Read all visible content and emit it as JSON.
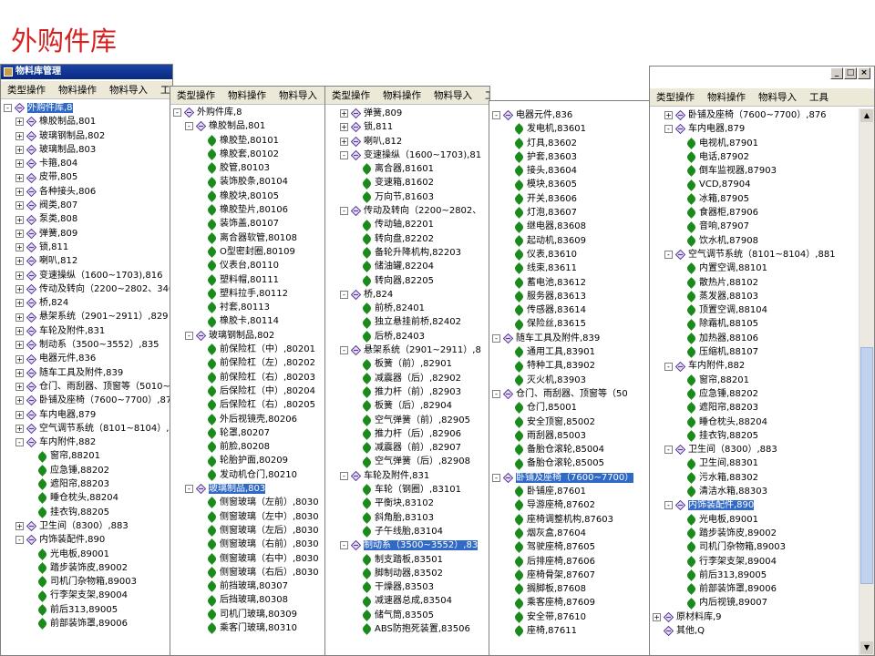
{
  "slide_title": "外购件库",
  "window": {
    "title": "物料库管理",
    "min": "_",
    "max": "□",
    "close": "×"
  },
  "panels": [
    {
      "menu": [
        "类型操作",
        "物料操作",
        "物料导入",
        "工具"
      ],
      "rows": [
        {
          "d": 0,
          "t": "n",
          "e": "-",
          "l": "外购件库,8",
          "s": true
        },
        {
          "d": 1,
          "t": "n",
          "e": "+",
          "l": "橡胶制品,801"
        },
        {
          "d": 1,
          "t": "n",
          "e": "+",
          "l": "玻璃钢制品,802"
        },
        {
          "d": 1,
          "t": "n",
          "e": "+",
          "l": "玻璃制品,803"
        },
        {
          "d": 1,
          "t": "n",
          "e": "+",
          "l": "卡箍,804"
        },
        {
          "d": 1,
          "t": "n",
          "e": "+",
          "l": "皮带,805"
        },
        {
          "d": 1,
          "t": "n",
          "e": "+",
          "l": "各种接头,806"
        },
        {
          "d": 1,
          "t": "n",
          "e": "+",
          "l": "阀类,807"
        },
        {
          "d": 1,
          "t": "n",
          "e": "+",
          "l": "泵类,808"
        },
        {
          "d": 1,
          "t": "n",
          "e": "+",
          "l": "弹簧,809"
        },
        {
          "d": 1,
          "t": "n",
          "e": "+",
          "l": "锁,811"
        },
        {
          "d": 1,
          "t": "n",
          "e": "+",
          "l": "喇叭,812"
        },
        {
          "d": 1,
          "t": "n",
          "e": "+",
          "l": "变速操纵（1600~1703),816"
        },
        {
          "d": 1,
          "t": "n",
          "e": "+",
          "l": "传动及转向（2200~2802、3400~34"
        },
        {
          "d": 1,
          "t": "n",
          "e": "+",
          "l": "桥,824"
        },
        {
          "d": 1,
          "t": "n",
          "e": "+",
          "l": "悬架系统（2901~2911）,829"
        },
        {
          "d": 1,
          "t": "n",
          "e": "+",
          "l": "车轮及附件,831"
        },
        {
          "d": 1,
          "t": "n",
          "e": "+",
          "l": "制动系（3500~3552）,835"
        },
        {
          "d": 1,
          "t": "n",
          "e": "+",
          "l": "电器元件,836"
        },
        {
          "d": 1,
          "t": "n",
          "e": "+",
          "l": "随车工具及附件,839"
        },
        {
          "d": 1,
          "t": "n",
          "e": "+",
          "l": "仓门、雨刮器、顶窗等（5010~6701"
        },
        {
          "d": 1,
          "t": "n",
          "e": "+",
          "l": "卧铺及座椅（7600~7700）,876"
        },
        {
          "d": 1,
          "t": "n",
          "e": "+",
          "l": "车内电器,879"
        },
        {
          "d": 1,
          "t": "n",
          "e": "+",
          "l": "空气调节系统（8101~8104）,881"
        },
        {
          "d": 1,
          "t": "n",
          "e": "-",
          "l": "车内附件,882"
        },
        {
          "d": 2,
          "t": "l",
          "l": "窗帘,88201"
        },
        {
          "d": 2,
          "t": "l",
          "l": "应急锤,88202"
        },
        {
          "d": 2,
          "t": "l",
          "l": "遮阳帘,88203"
        },
        {
          "d": 2,
          "t": "l",
          "l": "睡仓枕头,88204"
        },
        {
          "d": 2,
          "t": "l",
          "l": "挂衣钩,88205"
        },
        {
          "d": 1,
          "t": "n",
          "e": "+",
          "l": "卫生间（8300）,883"
        },
        {
          "d": 1,
          "t": "n",
          "e": "-",
          "l": "内饰装配件,890"
        },
        {
          "d": 2,
          "t": "l",
          "l": "光电板,89001"
        },
        {
          "d": 2,
          "t": "l",
          "l": "踏步装饰皮,89002"
        },
        {
          "d": 2,
          "t": "l",
          "l": "司机门杂物箱,89003"
        },
        {
          "d": 2,
          "t": "l",
          "l": "行李架支架,89004"
        },
        {
          "d": 2,
          "t": "l",
          "l": "前后313,89005"
        },
        {
          "d": 2,
          "t": "l",
          "l": "前部装饰罩,89006"
        }
      ]
    },
    {
      "menu": [
        "类型操作",
        "物料操作",
        "物料导入"
      ],
      "rows": [
        {
          "d": 0,
          "t": "n",
          "e": "-",
          "l": "外购件库,8"
        },
        {
          "d": 1,
          "t": "n",
          "e": "-",
          "l": "橡胶制品,801"
        },
        {
          "d": 2,
          "t": "l",
          "l": "橡胶垫,80101"
        },
        {
          "d": 2,
          "t": "l",
          "l": "橡胶套,80102"
        },
        {
          "d": 2,
          "t": "l",
          "l": "胶管,80103"
        },
        {
          "d": 2,
          "t": "l",
          "l": "装饰胶条,80104"
        },
        {
          "d": 2,
          "t": "l",
          "l": "橡胶块,80105"
        },
        {
          "d": 2,
          "t": "l",
          "l": "橡胶垫片,80106"
        },
        {
          "d": 2,
          "t": "l",
          "l": "装饰盖,80107"
        },
        {
          "d": 2,
          "t": "l",
          "l": "离合器软管,80108"
        },
        {
          "d": 2,
          "t": "l",
          "l": "O型密封圈,80109"
        },
        {
          "d": 2,
          "t": "l",
          "l": "仪表台,80110"
        },
        {
          "d": 2,
          "t": "l",
          "l": "塑料帽,80111"
        },
        {
          "d": 2,
          "t": "l",
          "l": "塑料拉手,80112"
        },
        {
          "d": 2,
          "t": "l",
          "l": "衬套,80113"
        },
        {
          "d": 2,
          "t": "l",
          "l": "橡胶卡,80114"
        },
        {
          "d": 1,
          "t": "n",
          "e": "-",
          "l": "玻璃钢制品,802"
        },
        {
          "d": 2,
          "t": "l",
          "l": "前保险杠（中）,80201"
        },
        {
          "d": 2,
          "t": "l",
          "l": "前保险杠（左）,80202"
        },
        {
          "d": 2,
          "t": "l",
          "l": "前保险杠（右）,80203"
        },
        {
          "d": 2,
          "t": "l",
          "l": "后保险杠（中）,80204"
        },
        {
          "d": 2,
          "t": "l",
          "l": "后保险杠（右）,80205"
        },
        {
          "d": 2,
          "t": "l",
          "l": "外后视镜壳,80206"
        },
        {
          "d": 2,
          "t": "l",
          "l": "轮罩,80207"
        },
        {
          "d": 2,
          "t": "l",
          "l": "前脸,80208"
        },
        {
          "d": 2,
          "t": "l",
          "l": "轮胎护面,80209"
        },
        {
          "d": 2,
          "t": "l",
          "l": "发动机仓门,80210"
        },
        {
          "d": 1,
          "t": "n",
          "e": "-",
          "l": "玻璃制品,803",
          "s": true
        },
        {
          "d": 2,
          "t": "l",
          "l": "侧窗玻璃（左前）,8030"
        },
        {
          "d": 2,
          "t": "l",
          "l": "侧窗玻璃（左中）,8030"
        },
        {
          "d": 2,
          "t": "l",
          "l": "侧窗玻璃（左后）,8030"
        },
        {
          "d": 2,
          "t": "l",
          "l": "侧窗玻璃（右前）,8030"
        },
        {
          "d": 2,
          "t": "l",
          "l": "侧窗玻璃（右中）,8030"
        },
        {
          "d": 2,
          "t": "l",
          "l": "侧窗玻璃（右后）,8030"
        },
        {
          "d": 2,
          "t": "l",
          "l": "前挡玻璃,80307"
        },
        {
          "d": 2,
          "t": "l",
          "l": "后挡玻璃,80308"
        },
        {
          "d": 2,
          "t": "l",
          "l": "司机门玻璃,80309"
        },
        {
          "d": 2,
          "t": "l",
          "l": "乘客门玻璃,80310"
        }
      ]
    },
    {
      "menu": [
        "类型操作",
        "物料操作",
        "物料导入",
        "工具"
      ],
      "rows": [
        {
          "d": 1,
          "t": "n",
          "e": "+",
          "l": "弹簧,809"
        },
        {
          "d": 1,
          "t": "n",
          "e": "+",
          "l": "锁,811"
        },
        {
          "d": 1,
          "t": "n",
          "e": "+",
          "l": "喇叭,812"
        },
        {
          "d": 1,
          "t": "n",
          "e": "-",
          "l": "变速操纵（1600~1703),81"
        },
        {
          "d": 2,
          "t": "l",
          "l": "离合器,81601"
        },
        {
          "d": 2,
          "t": "l",
          "l": "变速箱,81602"
        },
        {
          "d": 2,
          "t": "l",
          "l": "万向节,81603"
        },
        {
          "d": 1,
          "t": "n",
          "e": "-",
          "l": "传动及转向（2200~2802、"
        },
        {
          "d": 2,
          "t": "l",
          "l": "传动轴,82201"
        },
        {
          "d": 2,
          "t": "l",
          "l": "转向盘,82202"
        },
        {
          "d": 2,
          "t": "l",
          "l": "备轮升降机构,82203"
        },
        {
          "d": 2,
          "t": "l",
          "l": "储油罐,82204"
        },
        {
          "d": 2,
          "t": "l",
          "l": "转向器,82205"
        },
        {
          "d": 1,
          "t": "n",
          "e": "-",
          "l": "桥,824"
        },
        {
          "d": 2,
          "t": "l",
          "l": "前桥,82401"
        },
        {
          "d": 2,
          "t": "l",
          "l": "独立悬挂前桥,82402"
        },
        {
          "d": 2,
          "t": "l",
          "l": "后桥,82403"
        },
        {
          "d": 1,
          "t": "n",
          "e": "-",
          "l": "悬架系统（2901~2911）,8"
        },
        {
          "d": 2,
          "t": "l",
          "l": "板簧（前）,82901"
        },
        {
          "d": 2,
          "t": "l",
          "l": "减震器（后）,82902"
        },
        {
          "d": 2,
          "t": "l",
          "l": "推力杆（前）,82903"
        },
        {
          "d": 2,
          "t": "l",
          "l": "板簧（后）,82904"
        },
        {
          "d": 2,
          "t": "l",
          "l": "空气弹簧（前）,82905"
        },
        {
          "d": 2,
          "t": "l",
          "l": "推力杆（后）,82906"
        },
        {
          "d": 2,
          "t": "l",
          "l": "减震器（前）,82907"
        },
        {
          "d": 2,
          "t": "l",
          "l": "空气弹簧（后）,82908"
        },
        {
          "d": 1,
          "t": "n",
          "e": "-",
          "l": "车轮及附件,831"
        },
        {
          "d": 2,
          "t": "l",
          "l": "车轮（钢圈）,83101"
        },
        {
          "d": 2,
          "t": "l",
          "l": "平衡块,83102"
        },
        {
          "d": 2,
          "t": "l",
          "l": "斜角胎,83103"
        },
        {
          "d": 2,
          "t": "l",
          "l": "子午线胎,83104"
        },
        {
          "d": 1,
          "t": "n",
          "e": "-",
          "l": "制动系（3500~3552）,83",
          "s": true
        },
        {
          "d": 2,
          "t": "l",
          "l": "制支踏板,83501"
        },
        {
          "d": 2,
          "t": "l",
          "l": "脚制动器,83502"
        },
        {
          "d": 2,
          "t": "l",
          "l": "干燥器,83503"
        },
        {
          "d": 2,
          "t": "l",
          "l": "减速器总成,83504"
        },
        {
          "d": 2,
          "t": "l",
          "l": "储气筒,83505"
        },
        {
          "d": 2,
          "t": "l",
          "l": "ABS防抱死装置,83506"
        }
      ]
    },
    {
      "menu": [],
      "rows": [
        {
          "d": 0,
          "t": "n",
          "e": "-",
          "l": "电器元件,836"
        },
        {
          "d": 1,
          "t": "l",
          "l": "发电机,83601"
        },
        {
          "d": 1,
          "t": "l",
          "l": "灯具,83602"
        },
        {
          "d": 1,
          "t": "l",
          "l": "护套,83603"
        },
        {
          "d": 1,
          "t": "l",
          "l": "接头,83604"
        },
        {
          "d": 1,
          "t": "l",
          "l": "模块,83605"
        },
        {
          "d": 1,
          "t": "l",
          "l": "开关,83606"
        },
        {
          "d": 1,
          "t": "l",
          "l": "灯泡,83607"
        },
        {
          "d": 1,
          "t": "l",
          "l": "继电器,83608"
        },
        {
          "d": 1,
          "t": "l",
          "l": "起动机,83609"
        },
        {
          "d": 1,
          "t": "l",
          "l": "仪表,83610"
        },
        {
          "d": 1,
          "t": "l",
          "l": "线束,83611"
        },
        {
          "d": 1,
          "t": "l",
          "l": "蓄电池,83612"
        },
        {
          "d": 1,
          "t": "l",
          "l": "服务器,83613"
        },
        {
          "d": 1,
          "t": "l",
          "l": "传感器,83614"
        },
        {
          "d": 1,
          "t": "l",
          "l": "保险丝,83615"
        },
        {
          "d": 0,
          "t": "n",
          "e": "-",
          "l": "随车工具及附件,839"
        },
        {
          "d": 1,
          "t": "l",
          "l": "通用工具,83901"
        },
        {
          "d": 1,
          "t": "l",
          "l": "特种工具,83902"
        },
        {
          "d": 1,
          "t": "l",
          "l": "灭火机,83903"
        },
        {
          "d": 0,
          "t": "n",
          "e": "-",
          "l": "仓门、雨刮器、顶窗等（50"
        },
        {
          "d": 1,
          "t": "l",
          "l": "仓门,85001"
        },
        {
          "d": 1,
          "t": "l",
          "l": "安全顶窗,85002"
        },
        {
          "d": 1,
          "t": "l",
          "l": "雨刮器,85003"
        },
        {
          "d": 1,
          "t": "l",
          "l": "备胎仓滚轮,85004"
        },
        {
          "d": 1,
          "t": "l",
          "l": "备胎仓滚轮,85005"
        },
        {
          "d": 0,
          "t": "n",
          "e": "-",
          "l": "卧铺及座椅（7600~7700）",
          "s": true
        },
        {
          "d": 1,
          "t": "l",
          "l": "卧铺座,87601"
        },
        {
          "d": 1,
          "t": "l",
          "l": "导游座椅,87602"
        },
        {
          "d": 1,
          "t": "l",
          "l": "座椅调整机构,87603"
        },
        {
          "d": 1,
          "t": "l",
          "l": "烟灰盒,87604"
        },
        {
          "d": 1,
          "t": "l",
          "l": "驾驶座椅,87605"
        },
        {
          "d": 1,
          "t": "l",
          "l": "后排座椅,87606"
        },
        {
          "d": 1,
          "t": "l",
          "l": "座椅骨架,87607"
        },
        {
          "d": 1,
          "t": "l",
          "l": "搁脚板,87608"
        },
        {
          "d": 1,
          "t": "l",
          "l": "乘客座椅,87609"
        },
        {
          "d": 1,
          "t": "l",
          "l": "安全带,87610"
        },
        {
          "d": 1,
          "t": "l",
          "l": "座椅,87611"
        }
      ]
    },
    {
      "menu": [
        "类型操作",
        "物料操作",
        "物料导入",
        "工具"
      ],
      "rows": [
        {
          "d": 1,
          "t": "n",
          "e": "+",
          "l": "卧铺及座椅（7600~7700）,876"
        },
        {
          "d": 1,
          "t": "n",
          "e": "-",
          "l": "车内电器,879"
        },
        {
          "d": 2,
          "t": "l",
          "l": "电视机,87901"
        },
        {
          "d": 2,
          "t": "l",
          "l": "电话,87902"
        },
        {
          "d": 2,
          "t": "l",
          "l": "倒车监视器,87903"
        },
        {
          "d": 2,
          "t": "l",
          "l": "VCD,87904"
        },
        {
          "d": 2,
          "t": "l",
          "l": "冰箱,87905"
        },
        {
          "d": 2,
          "t": "l",
          "l": "食器柜,87906"
        },
        {
          "d": 2,
          "t": "l",
          "l": "音响,87907"
        },
        {
          "d": 2,
          "t": "l",
          "l": "饮水机,87908"
        },
        {
          "d": 1,
          "t": "n",
          "e": "-",
          "l": "空气调节系统（8101~8104）,881"
        },
        {
          "d": 2,
          "t": "l",
          "l": "内置空调,88101"
        },
        {
          "d": 2,
          "t": "l",
          "l": "散热片,88102"
        },
        {
          "d": 2,
          "t": "l",
          "l": "蒸发器,88103"
        },
        {
          "d": 2,
          "t": "l",
          "l": "顶置空调,88104"
        },
        {
          "d": 2,
          "t": "l",
          "l": "除霜机,88105"
        },
        {
          "d": 2,
          "t": "l",
          "l": "加热器,88106"
        },
        {
          "d": 2,
          "t": "l",
          "l": "压缩机,88107"
        },
        {
          "d": 1,
          "t": "n",
          "e": "-",
          "l": "车内附件,882"
        },
        {
          "d": 2,
          "t": "l",
          "l": "窗帘,88201"
        },
        {
          "d": 2,
          "t": "l",
          "l": "应急锤,88202"
        },
        {
          "d": 2,
          "t": "l",
          "l": "遮阳帘,88203"
        },
        {
          "d": 2,
          "t": "l",
          "l": "睡仓枕头,88204"
        },
        {
          "d": 2,
          "t": "l",
          "l": "挂衣钩,88205"
        },
        {
          "d": 1,
          "t": "n",
          "e": "-",
          "l": "卫生间（8300）,883"
        },
        {
          "d": 2,
          "t": "l",
          "l": "卫生间,88301"
        },
        {
          "d": 2,
          "t": "l",
          "l": "污水箱,88302"
        },
        {
          "d": 2,
          "t": "l",
          "l": "清洁水箱,88303"
        },
        {
          "d": 1,
          "t": "n",
          "e": "-",
          "l": "内饰装配件,890",
          "s": true
        },
        {
          "d": 2,
          "t": "l",
          "l": "光电板,89001"
        },
        {
          "d": 2,
          "t": "l",
          "l": "踏步装饰皮,89002"
        },
        {
          "d": 2,
          "t": "l",
          "l": "司机门杂物箱,89003"
        },
        {
          "d": 2,
          "t": "l",
          "l": "行李架支架,89004"
        },
        {
          "d": 2,
          "t": "l",
          "l": "前后313,89005"
        },
        {
          "d": 2,
          "t": "l",
          "l": "前部装饰罩,89006"
        },
        {
          "d": 2,
          "t": "l",
          "l": "内后视镜,89007"
        },
        {
          "d": 0,
          "t": "n",
          "e": "+",
          "l": "原材料库,9"
        },
        {
          "d": 0,
          "t": "n",
          "e": "",
          "l": "其他,Q"
        }
      ]
    }
  ]
}
